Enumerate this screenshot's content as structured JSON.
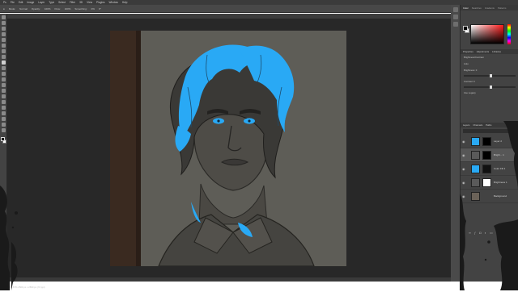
{
  "app": {
    "menu": [
      "Ps",
      "File",
      "Edit",
      "Image",
      "Layer",
      "Type",
      "Select",
      "Filter",
      "3D",
      "View",
      "Plugins",
      "Window",
      "Help"
    ],
    "options": {
      "mode_label": "Mode:",
      "mode_value": "Normal",
      "opacity_label": "Opacity:",
      "opacity_value": "100%",
      "flow_label": "Flow:",
      "flow_value": "100%",
      "smoothing_label": "Smoothing:",
      "smoothing_value": "0%",
      "angle_value": "0°"
    },
    "document_tab": "#7 Timothee Chalamet sketch.jpg @ 66.7% (Brightness/Contrast 1, Layer Mask/8)",
    "status": "66.67%   2560 px x 2560 px (72 ppi)"
  },
  "panels": {
    "color_tabs": [
      "Color",
      "Swatches",
      "Gradients",
      "Patterns"
    ],
    "properties_tabs": [
      "Properties",
      "Adjustments",
      "Libraries"
    ],
    "properties_title": "Brightness/Contrast",
    "auto_label": "Auto",
    "brightness_label": "Brightness:",
    "brightness_value": "0",
    "contrast_label": "Contrast:",
    "contrast_value": "0",
    "legacy_label": "Use Legacy",
    "layers_tabs": [
      "Layers",
      "Channels",
      "Paths"
    ],
    "layers": [
      {
        "name": "Layer 2",
        "selected": false
      },
      {
        "name": "Bright... 1",
        "selected": true
      },
      {
        "name": "Color Fill 1",
        "selected": false
      },
      {
        "name": "Brightness 1",
        "selected": false
      },
      {
        "name": "Background",
        "selected": false
      }
    ]
  },
  "colors": {
    "accent_blue": "#29a9f5",
    "canvas_bg": "#282828",
    "panel_bg": "#434343"
  }
}
